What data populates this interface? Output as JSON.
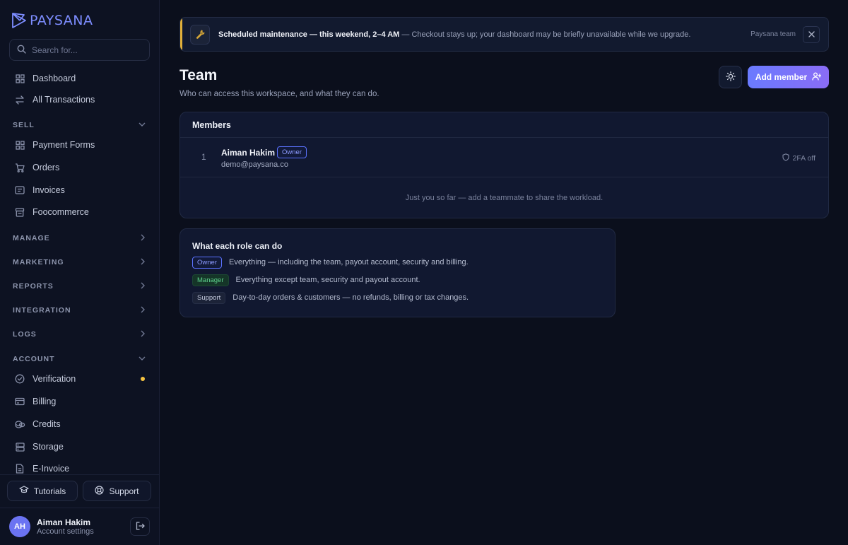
{
  "brand": {
    "name": "PAYSANA"
  },
  "search": {
    "placeholder": "Search for..."
  },
  "sidebar": {
    "top_items": [
      {
        "label": "Dashboard",
        "icon": "grid-icon"
      },
      {
        "label": "All Transactions",
        "icon": "arrows-swap-icon"
      }
    ],
    "sections": {
      "sell": {
        "label": "SELL",
        "expanded": true
      },
      "manage": {
        "label": "MANAGE"
      },
      "marketing": {
        "label": "MARKETING"
      },
      "reports": {
        "label": "REPORTS"
      },
      "integration": {
        "label": "INTEGRATION"
      },
      "logs": {
        "label": "LOGS"
      },
      "account": {
        "label": "ACCOUNT",
        "expanded": true
      }
    },
    "sell_items": [
      {
        "label": "Payment Forms",
        "icon": "grid-icon"
      },
      {
        "label": "Orders",
        "icon": "cart-icon"
      },
      {
        "label": "Invoices",
        "icon": "invoice-icon"
      },
      {
        "label": "Foocommerce",
        "icon": "store-icon"
      }
    ],
    "account_items": [
      {
        "label": "Verification",
        "icon": "check-badge-icon",
        "has_dot": true
      },
      {
        "label": "Billing",
        "icon": "card-icon"
      },
      {
        "label": "Credits",
        "icon": "coins-icon"
      },
      {
        "label": "Storage",
        "icon": "storage-icon"
      },
      {
        "label": "E-Invoice",
        "icon": "document-icon"
      }
    ],
    "tutorials_label": "Tutorials",
    "support_label": "Support",
    "user": {
      "initials": "AH",
      "name": "Aiman Hakim",
      "sub": "Account settings"
    }
  },
  "banner": {
    "title": "Scheduled maintenance — this weekend, 2–4 AM",
    "text": " — Checkout stays up; your dashboard may be briefly unavailable while we upgrade.",
    "signature": "Paysana team",
    "accent_color": "#e2b13a"
  },
  "page": {
    "title": "Team",
    "subtitle": "Who can access this workspace, and what they can do.",
    "add_member_label": "Add member"
  },
  "members": {
    "heading": "Members",
    "rows": [
      {
        "index": "1",
        "name": "Aiman Hakim",
        "role": "Owner",
        "email": "demo@paysana.co",
        "twofa": "2FA off"
      }
    ],
    "empty_text": "Just you so far — add a teammate to share the workload."
  },
  "roles": {
    "heading": "What each role can do",
    "items": [
      {
        "role": "Owner",
        "description": "Everything — including the team, payout account, security and billing."
      },
      {
        "role": "Manager",
        "description": "Everything except team, security and payout account."
      },
      {
        "role": "Support",
        "description": "Day-to-day orders & customers — no refunds, billing or tax changes."
      }
    ]
  }
}
